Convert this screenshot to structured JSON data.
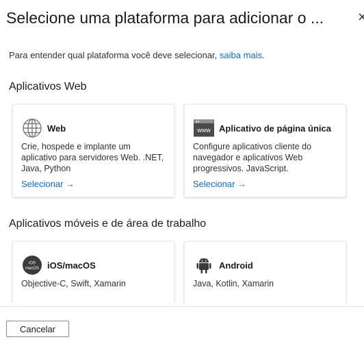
{
  "panel": {
    "title": "Selecione uma plataforma para adicionar o ...",
    "close_glyph": "×",
    "intro_text": "Para entender qual plataforma você deve selecionar, ",
    "intro_link": "saiba mais",
    "intro_end": "."
  },
  "sections": {
    "web": {
      "title": "Aplicativos Web"
    },
    "mobile": {
      "title": "Aplicativos móveis e de área de trabalho"
    }
  },
  "cards": {
    "web": {
      "icon": "globe-icon",
      "title": "Web",
      "description": "Crie, hospede e implante um aplicativo para servidores Web. .NET, Java, Python",
      "action": "Selecionar →"
    },
    "spa": {
      "icon": "www-browser-icon",
      "icon_text": "www",
      "title": "Aplicativo de página única",
      "description": "Configure aplicativos cliente do navegador e aplicativos Web progressivos. JavaScript.",
      "action": "Selecionar →"
    },
    "ios": {
      "icon": "ios-macos-icon",
      "icon_text_1": "iOS",
      "icon_text_2": "macOS",
      "title": "iOS/macOS",
      "description": "Objective-C, Swift, Xamarin"
    },
    "android": {
      "icon": "android-icon",
      "title": "Android",
      "description": "Java, Kotlin, Xamarin"
    }
  },
  "footer": {
    "cancel_label": "Cancelar"
  },
  "colors": {
    "link": "#0f6cbd",
    "text": "#1b1b1b",
    "border": "#8a8886"
  }
}
